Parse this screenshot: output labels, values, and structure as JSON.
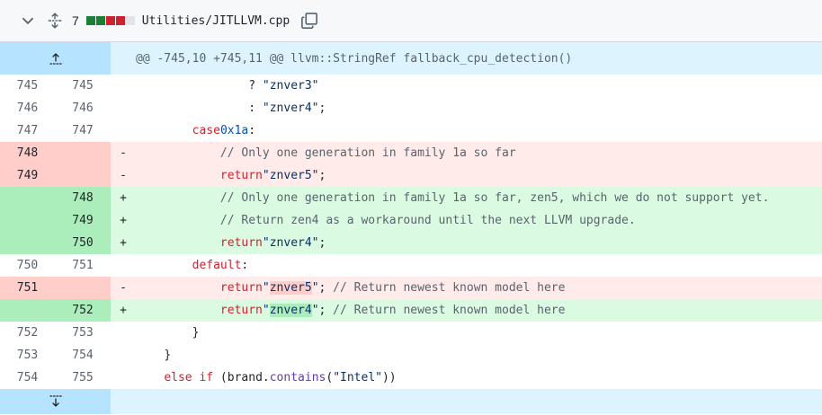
{
  "file": {
    "change_count": "7",
    "name": "Utilities/JITLLVM.cpp",
    "diffstat_colors": [
      "#1a7f37",
      "#1a7f37",
      "#cf222e",
      "#cf222e",
      "#e1e4e8"
    ]
  },
  "hunk": {
    "header": "@@ -745,10 +745,11 @@ llvm::StringRef fallback_cpu_detection()"
  },
  "lines": [
    {
      "type": "ctx",
      "old": "745",
      "new": "745",
      "sign": "",
      "code_pre": "                ? ",
      "str": "\"znver3\"",
      "code_post": ""
    },
    {
      "type": "ctx",
      "old": "746",
      "new": "746",
      "sign": "",
      "code_pre": "                : ",
      "str": "\"znver4\"",
      "code_post": ";"
    },
    {
      "type": "ctx",
      "old": "747",
      "new": "747",
      "sign": "",
      "indent": "        ",
      "kw": "case",
      "num": "0x1a",
      "rest": ":"
    },
    {
      "type": "del",
      "old": "748",
      "new": "",
      "sign": "-",
      "indent": "            ",
      "comment": "// Only one generation in family 1a so far"
    },
    {
      "type": "del",
      "old": "749",
      "new": "",
      "sign": "-",
      "indent": "            ",
      "kw": "return",
      "str": "\"znver5\"",
      "rest": ";"
    },
    {
      "type": "add",
      "old": "",
      "new": "748",
      "sign": "+",
      "indent": "            ",
      "comment": "// Only one generation in family 1a so far, zen5, which we do not support yet."
    },
    {
      "type": "add",
      "old": "",
      "new": "749",
      "sign": "+",
      "indent": "            ",
      "comment": "// Return zen4 as a workaround until the next LLVM upgrade."
    },
    {
      "type": "add",
      "old": "",
      "new": "750",
      "sign": "+",
      "indent": "            ",
      "kw": "return",
      "str": "\"znver4\"",
      "rest": ";"
    },
    {
      "type": "ctx",
      "old": "750",
      "new": "751",
      "sign": "",
      "indent": "        ",
      "kw": "default",
      "rest": ":"
    },
    {
      "type": "del",
      "old": "751",
      "new": "",
      "sign": "-",
      "indent": "            ",
      "kw": "return",
      "q1": "\"",
      "hl": "znver5",
      "q2": "\"",
      "rest": "; ",
      "comment": "// Return newest known model here"
    },
    {
      "type": "add",
      "old": "",
      "new": "752",
      "sign": "+",
      "indent": "            ",
      "kw": "return",
      "q1": "\"",
      "hl": "znver4",
      "q2": "\"",
      "rest": "; ",
      "comment": "// Return newest known model here"
    },
    {
      "type": "ctx",
      "old": "752",
      "new": "753",
      "sign": "",
      "indent": "        ",
      "rest": "}"
    },
    {
      "type": "ctx",
      "old": "753",
      "new": "754",
      "sign": "",
      "indent": "    ",
      "rest": "}"
    },
    {
      "type": "ctx",
      "old": "754",
      "new": "755",
      "sign": "",
      "indent": "    ",
      "kw": "else if",
      "rest2": " (brand.",
      "fn": "contains",
      "rest3": "(",
      "str": "\"Intel\"",
      "rest4": "))"
    }
  ]
}
